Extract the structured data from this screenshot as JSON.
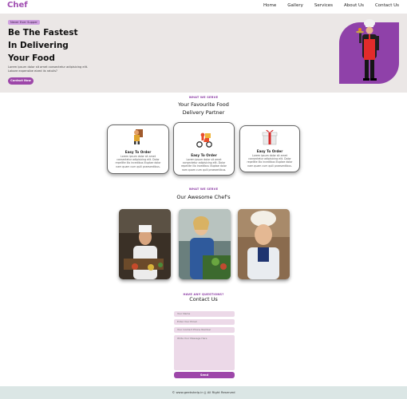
{
  "nav": {
    "logo": "Chef",
    "items": [
      "Home",
      "Gallery",
      "Services",
      "About Us",
      "Contact Us"
    ]
  },
  "hero": {
    "badge": "Never Ever Supper",
    "title_lines": [
      "Be The Fastest",
      "In Delivering",
      "Your Food"
    ],
    "text": "Lorem ipsum dolor sit amet consectetur adipisicing elit. Labore expensibe eized iis ratulis?",
    "button": "Contact Now"
  },
  "services": {
    "eyebrow": "WHAT WE SERVE",
    "title_lines": [
      "Your Favourite Food",
      "Delivery Partner"
    ],
    "cards": [
      {
        "icon": "chef-delivery-icon",
        "title": "Easy To Order",
        "text": "Lorem ipsum dolor sit amet consectetur adipisicing elit. Dolor repellite illo incedibus illuptae dolor nam quam cum quili praesentibus."
      },
      {
        "icon": "scooter-delivery-icon",
        "title": "Easy To Order",
        "text": "Lorem ipsum dolor sit amet consectetur adipisicing elit. Dolor repellite illo incedibus illuptae dolor nam quam cum quili praesentibus."
      },
      {
        "icon": "gift-box-icon",
        "title": "Easy To Order",
        "text": "Lorem ipsum dolor sit amet consectetur adipisicing elit. Dolor repellite illo incedibus illuptae dolor nam quam cum quili praesentibus."
      }
    ]
  },
  "chefs": {
    "eyebrow": "WHAT WE SERVE",
    "title": "Our Awesome Chef's"
  },
  "contact": {
    "eyebrow": "HAVE ANY QUESTIONS?",
    "title": "Contact Us",
    "fields": [
      "Your Name",
      "Enter Your Email",
      "Your Contact Phone Number"
    ],
    "message_placeholder": "Write Your Message Here",
    "send": "Send"
  },
  "footer": {
    "text": "© www.geekshelp.in || All Right Reserved"
  },
  "colors": {
    "accent": "#9d47a9",
    "hero_bg": "#ebe7e6",
    "field_bg": "#ecd9e8",
    "footer_bg": "#dbe6e5"
  }
}
